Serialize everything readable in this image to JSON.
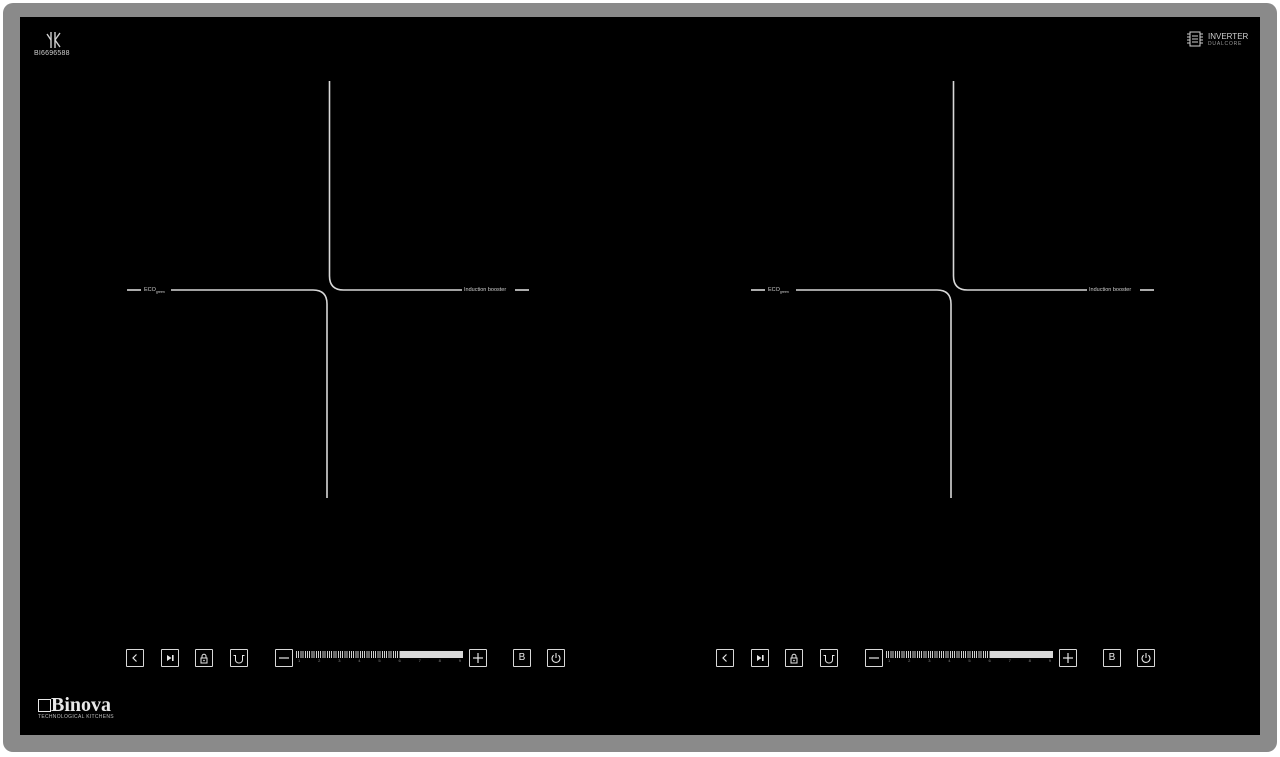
{
  "brand": {
    "model_number": "BI6696588",
    "model_icon": "hob-logo-icon",
    "inverter_title": "INVERTER",
    "inverter_subtitle": "DUALCORE",
    "name": "Binova",
    "tagline": "TECHNOLOGICAL KITCHENS"
  },
  "colors": {
    "frame": "#8a8a8a",
    "glass": "#000000",
    "markings": "#d8d8d8"
  },
  "zones": [
    {
      "left_label": "ECO",
      "left_label_sub": "green",
      "right_label": "Induction booster"
    },
    {
      "left_label": "ECO",
      "left_label_sub": "green",
      "right_label": "Induction booster"
    }
  ],
  "panels": [
    {
      "buttons": [
        "back-icon",
        "next-icon",
        "lock-icon",
        "pot-icon",
        "minus-icon",
        "plus-icon",
        "booster-icon",
        "power-icon"
      ],
      "booster_label": "B",
      "slider_numbers": [
        "1",
        "2",
        "3",
        "4",
        "5",
        "6",
        "7",
        "8",
        "9"
      ]
    },
    {
      "buttons": [
        "back-icon",
        "next-icon",
        "lock-icon",
        "pot-icon",
        "minus-icon",
        "plus-icon",
        "booster-icon",
        "power-icon"
      ],
      "booster_label": "B",
      "slider_numbers": [
        "1",
        "2",
        "3",
        "4",
        "5",
        "6",
        "7",
        "8",
        "9"
      ]
    }
  ]
}
